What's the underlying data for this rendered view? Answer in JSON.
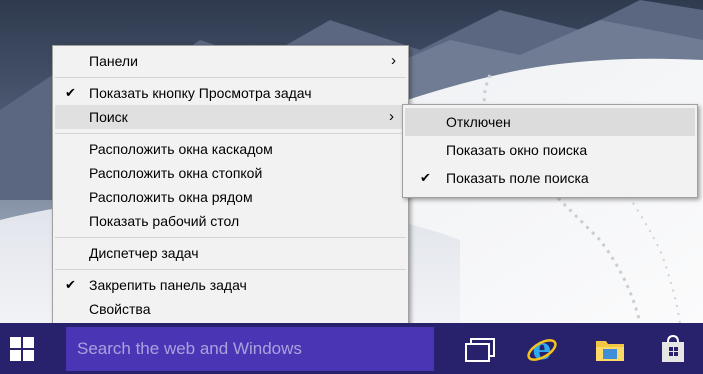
{
  "context_menu": {
    "items": [
      {
        "label": "Панели",
        "checked": false,
        "submenu": true
      },
      {
        "label": "Показать кнопку Просмотра задач",
        "checked": true,
        "submenu": false
      },
      {
        "label": "Поиск",
        "checked": false,
        "submenu": true,
        "highlighted": true
      },
      {
        "label": "Расположить окна каскадом",
        "checked": false,
        "submenu": false
      },
      {
        "label": "Расположить окна стопкой",
        "checked": false,
        "submenu": false
      },
      {
        "label": "Расположить окна рядом",
        "checked": false,
        "submenu": false
      },
      {
        "label": "Показать рабочий стол",
        "checked": false,
        "submenu": false
      },
      {
        "label": "Диспетчер задач",
        "checked": false,
        "submenu": false
      },
      {
        "label": "Закрепить панель задач",
        "checked": true,
        "submenu": false
      },
      {
        "label": "Свойства",
        "checked": false,
        "submenu": false
      }
    ],
    "check_glyph": "✔",
    "arrow_glyph": "›"
  },
  "search_submenu": {
    "items": [
      {
        "label": "Отключен",
        "checked": false,
        "highlighted": true
      },
      {
        "label": "Показать окно поиска",
        "checked": false
      },
      {
        "label": "Показать поле поиска",
        "checked": true
      }
    ]
  },
  "taskbar": {
    "search_placeholder": "Search the web and Windows",
    "icons": [
      "windows-start-icon",
      "task-view-icon",
      "internet-explorer-icon",
      "file-explorer-icon",
      "store-icon"
    ],
    "colors": {
      "taskbar": "#28226d",
      "search_box": "#4a36b5",
      "menu_bg": "#f2f2f2",
      "menu_highlight": "#e0e0e0"
    }
  }
}
